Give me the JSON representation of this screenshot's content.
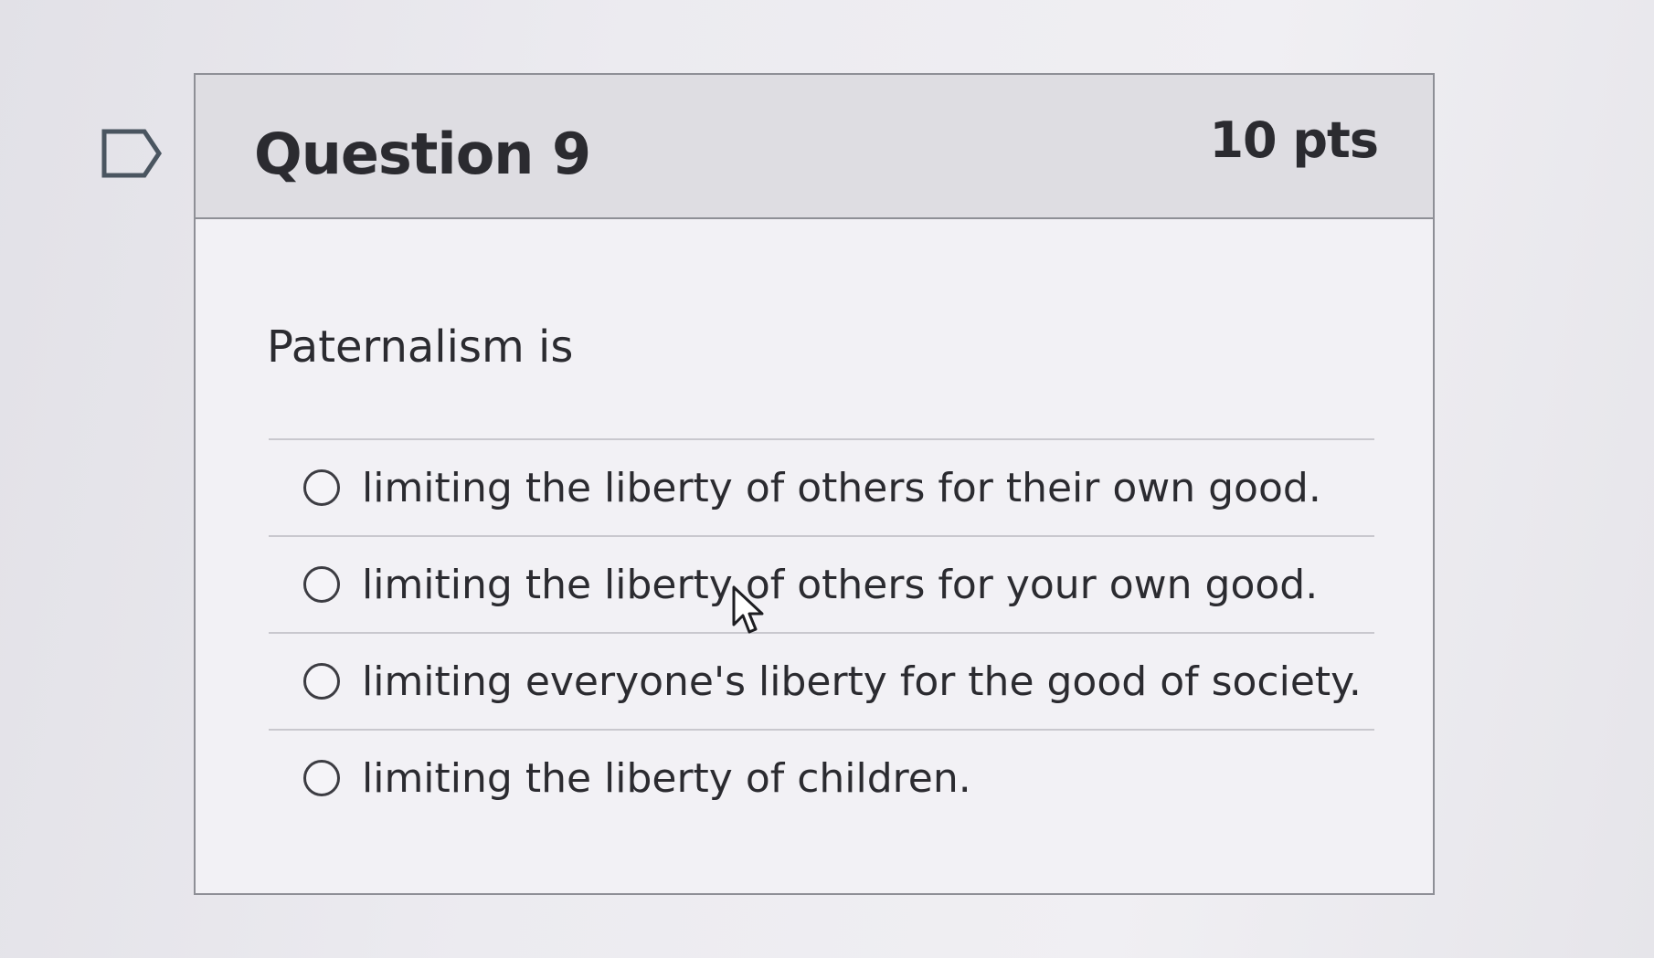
{
  "question": {
    "title": "Question 9",
    "points": "10 pts",
    "prompt": "Paternalism is",
    "flag_icon": "flag-outline-icon",
    "answers": [
      {
        "label": "limiting the liberty of others for their own good.",
        "selected": false
      },
      {
        "label": "limiting the liberty of others for your own good.",
        "selected": false
      },
      {
        "label": "limiting everyone's liberty for the good of society.",
        "selected": false
      },
      {
        "label": "limiting the liberty of children.",
        "selected": false
      }
    ]
  },
  "cursor_icon": "mouse-pointer-icon"
}
